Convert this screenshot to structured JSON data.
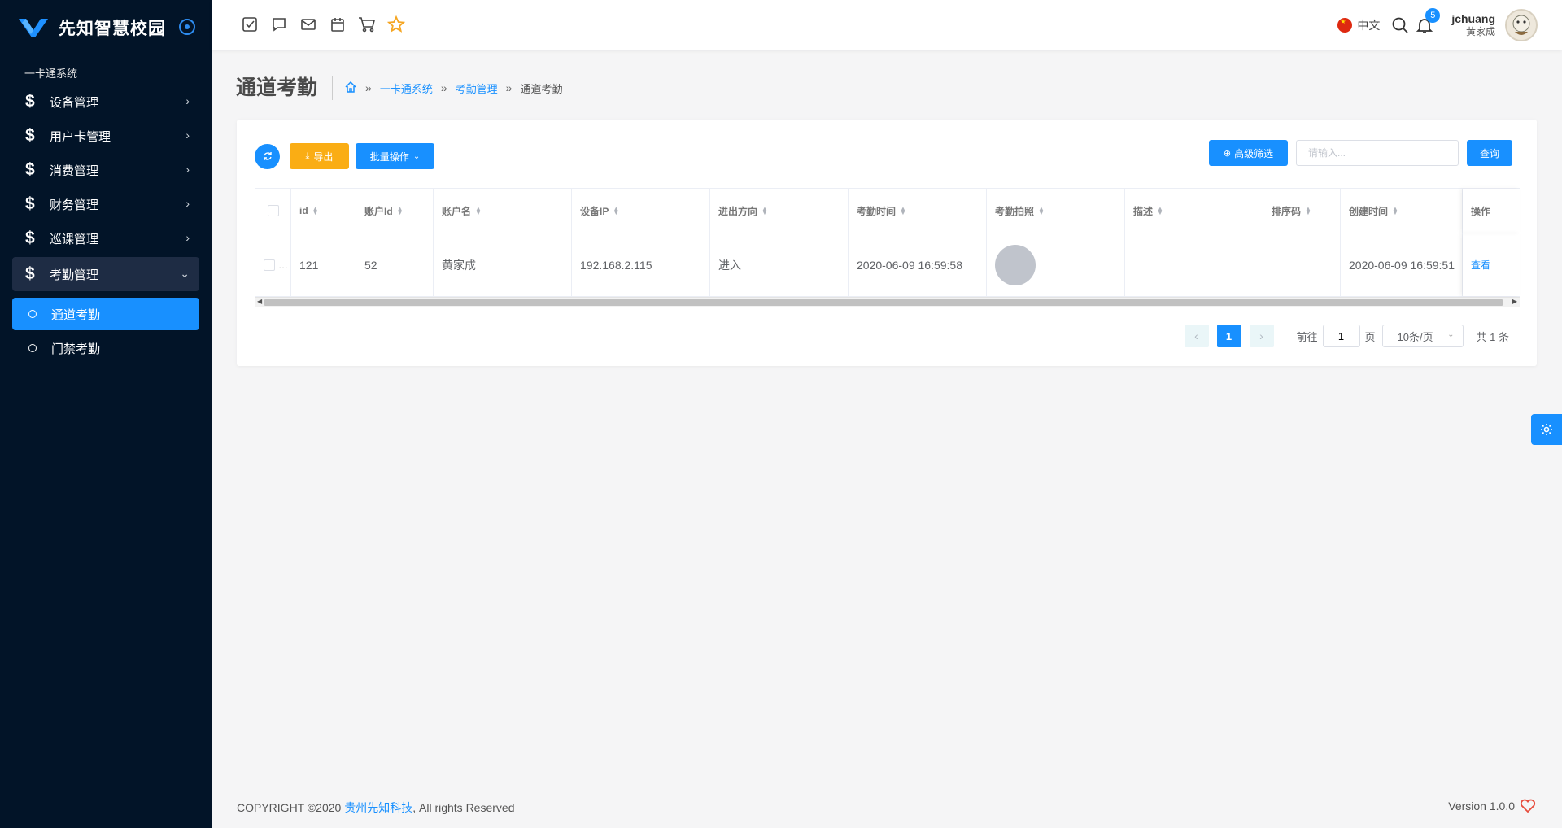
{
  "brand": {
    "title": "先知智慧校园"
  },
  "sidebar": {
    "section": "一卡通系统",
    "items": [
      {
        "label": "设备管理"
      },
      {
        "label": "用户卡管理"
      },
      {
        "label": "消费管理"
      },
      {
        "label": "财务管理"
      },
      {
        "label": "巡课管理"
      },
      {
        "label": "考勤管理"
      }
    ],
    "subitems": [
      {
        "label": "通道考勤"
      },
      {
        "label": "门禁考勤"
      }
    ]
  },
  "header": {
    "lang": "中文",
    "notification_count": "5",
    "user_name": "jchuang",
    "user_display": "黄家成"
  },
  "page": {
    "title": "通道考勤",
    "breadcrumb": [
      "一卡通系统",
      "考勤管理",
      "通道考勤"
    ],
    "breadcrumb_sep": "»"
  },
  "toolbar": {
    "export_label": "导出",
    "batch_label": "批量操作",
    "advanced_label": "高级筛选",
    "search_placeholder": "请输入...",
    "query_label": "查询"
  },
  "table": {
    "columns": [
      "id",
      "账户Id",
      "账户名",
      "设备IP",
      "进出方向",
      "考勤时间",
      "考勤拍照",
      "描述",
      "排序码",
      "创建时间",
      "操作"
    ],
    "rows": [
      {
        "id": "121",
        "account_id": "52",
        "account_name": "黄家成",
        "device_ip": "192.168.2.115",
        "direction": "进入",
        "time": "2020-06-09 16:59:58",
        "photo": "",
        "desc": "",
        "sort": "",
        "created": "2020-06-09 16:59:51",
        "action": "查看",
        "ellipsis": "…"
      }
    ]
  },
  "pager": {
    "current": "1",
    "goto_label": "前往",
    "goto_value": "1",
    "page_suffix": "页",
    "page_size": "10条/页",
    "total": "共 1 条"
  },
  "footer": {
    "copyright_prefix": "COPYRIGHT ©2020 ",
    "company": "贵州先知科技",
    "copyright_suffix": ", All rights Reserved",
    "version": "Version 1.0.0"
  },
  "colors": {
    "sidebar_bg": "#021428",
    "primary": "#1890ff",
    "warning": "#faad14",
    "active_parent": "#1e2c44"
  }
}
